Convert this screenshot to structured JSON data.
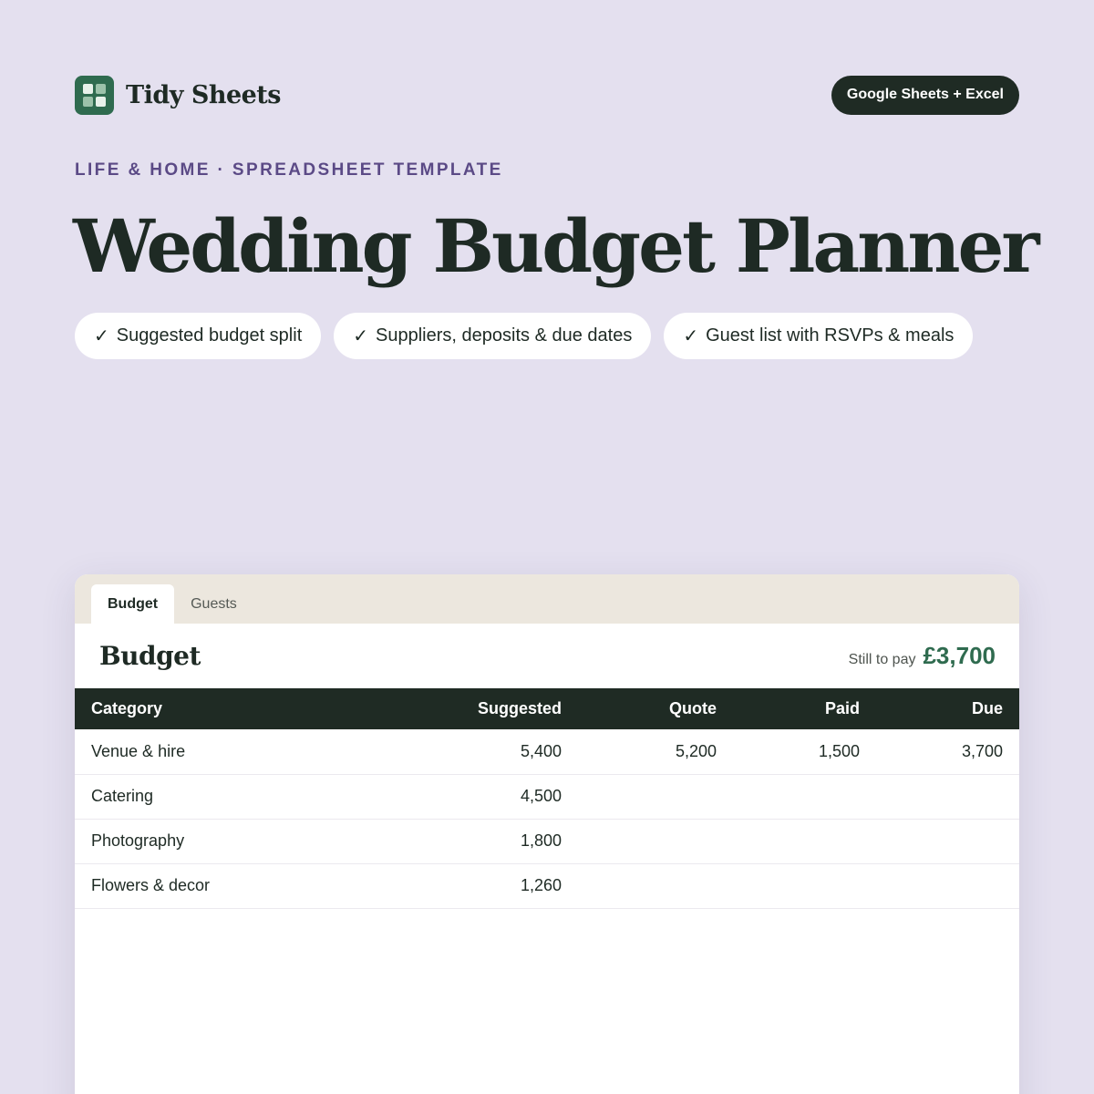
{
  "brand": {
    "name": "Tidy Sheets",
    "logo_icon": "grid-logo-icon",
    "accent": "#2f6b4f"
  },
  "platform_badge": "Google Sheets + Excel",
  "eyebrow": "LIFE & HOME · SPREADSHEET TEMPLATE",
  "title": "Wedding Budget Planner",
  "features": [
    {
      "check": "✓",
      "label": "Suggested budget split"
    },
    {
      "check": "✓",
      "label": "Suppliers, deposits & due dates"
    },
    {
      "check": "✓",
      "label": "Guest list with RSVPs & meals"
    }
  ],
  "sheet": {
    "tabs": [
      {
        "label": "Budget",
        "active": true
      },
      {
        "label": "Guests",
        "active": false
      }
    ],
    "title": "Budget",
    "summary_label": "Still to pay",
    "summary_value": "£3,700",
    "columns": [
      "Category",
      "Suggested",
      "Quote",
      "Paid",
      "Due"
    ],
    "rows": [
      [
        "Venue & hire",
        "5,400",
        "5,200",
        "1,500",
        "3,700"
      ],
      [
        "Catering",
        "4,500",
        "",
        "",
        ""
      ],
      [
        "Photography",
        "1,800",
        "",
        "",
        ""
      ],
      [
        "Flowers & decor",
        "1,260",
        "",
        "",
        ""
      ]
    ]
  },
  "colors": {
    "background": "#e4e0ef",
    "header_dark": "#1f2b24",
    "eyebrow": "#5b4a86",
    "tab_bar": "#ece7de"
  }
}
